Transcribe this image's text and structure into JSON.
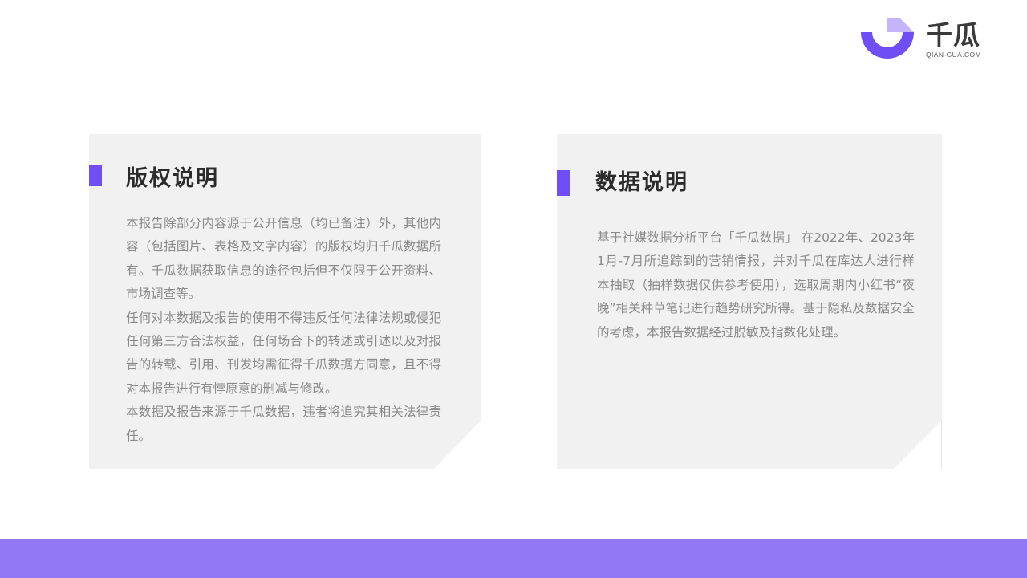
{
  "brand": {
    "name": "千瓜",
    "domain": "QIAN-GUA.COM",
    "icon": "qiangua-logo-icon",
    "colors": {
      "primary": "#6f4ef6",
      "light": "#c4b4f9",
      "footer": "#9278f5"
    }
  },
  "copyright": {
    "title": "版权说明",
    "paragraphs": [
      "本报告除部分内容源于公开信息（均已备注）外，其他内容（包括图片、表格及文字内容）的版权均归千瓜数据所有。千瓜数据获取信息的途径包括但不仅限于公开资料、市场调查等。",
      "任何对本数据及报告的使用不得违反任何法律法规或侵犯任何第三方合法权益，任何场合下的转述或引述以及对报告的转载、引用、刊发均需征得千瓜数据方同意，且不得对本报告进行有悖原意的删减与修改。",
      "本数据及报告来源于千瓜数据，违者将追究其相关法律责任。"
    ]
  },
  "data_note": {
    "title": "数据说明",
    "paragraphs": [
      "基于社媒数据分析平台「千瓜数据」 在2022年、2023年1月-7月所追踪到的营销情报，并对千瓜在库达人进行样本抽取（抽样数据仅供参考使用），选取周期内小红书“夜晚”相关种草笔记进行趋势研究所得。基于隐私及数据安全的考虑，本报告数据经过脱敏及指数化处理。"
    ]
  }
}
